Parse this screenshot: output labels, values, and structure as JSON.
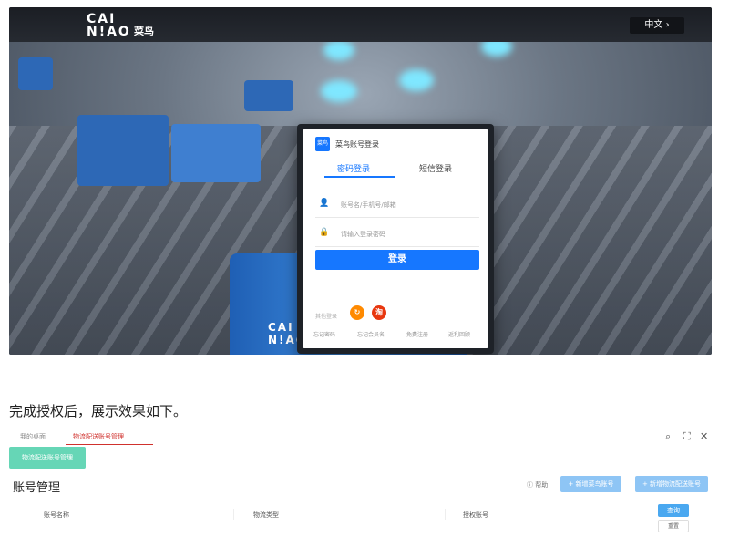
{
  "hero": {
    "logo_line1": "CAI",
    "logo_line2": "N!AO",
    "logo_cn": "菜鸟",
    "lang_label": "中文 ›",
    "cyl_line1": "CAI",
    "cyl_line2": "N!AO"
  },
  "login": {
    "brand_icon_text": "菜鸟",
    "title": "菜鸟账号登录",
    "tab_password": "密码登录",
    "tab_sms": "短信登录",
    "account_placeholder": "账号名/手机号/邮箱",
    "password_placeholder": "请输入登录密码",
    "submit_label": "登录",
    "other_label": "其他登录",
    "oauth_taobao_glyph": "淘",
    "oauth_other_glyph": "↻",
    "links": [
      "忘记密码",
      "忘记会员名",
      "免费注册",
      "返利回顾"
    ]
  },
  "caption": "完成授权后，展示效果如下。",
  "app": {
    "tabs": [
      "我的桌面",
      "物流配送账号管理"
    ],
    "active_tab_index": 1,
    "window_controls": [
      "search-icon",
      "expand-icon",
      "close-icon"
    ],
    "green_button_label": "物流配送账号管理",
    "page_title": "账号管理",
    "help_label": "帮助",
    "add_button_1": "+ 新增菜鸟账号",
    "add_button_2": "+ 新增物流配送账号",
    "columns": [
      "账号名称",
      "物流类型",
      "授权账号"
    ],
    "search_label": "查询",
    "reset_label": "重置"
  },
  "colors": {
    "primary": "#1677ff",
    "tab_active": "#d0312d",
    "green_button": "#66d6b6",
    "light_blue_button": "#8ec5f5"
  }
}
